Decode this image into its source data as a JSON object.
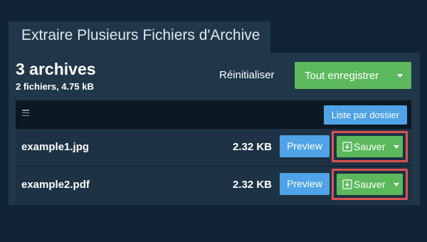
{
  "window": {
    "tab_title": "Extraire Plusieurs Fichiers d'Archive"
  },
  "summary": {
    "title": "3 archives",
    "subtitle": "2 fichiers, 4.75 kB"
  },
  "actions": {
    "reset_label": "Réinitialiser",
    "save_all_label": "Tout enregistrer"
  },
  "toolbar": {
    "menu_icon": "hamburger-icon",
    "by_folder_label": "Liste par dossier"
  },
  "files": [
    {
      "name": "example1.jpg",
      "size": "2.32 KB",
      "preview_label": "Preview",
      "save_label": "Sauver"
    },
    {
      "name": "example2.pdf",
      "size": "2.32 KB",
      "preview_label": "Preview",
      "save_label": "Sauver"
    }
  ],
  "colors": {
    "background": "#102436",
    "panel": "#203649",
    "success": "#5cb85c",
    "primary": "#4fa3e6",
    "highlight": "#d9534f"
  },
  "icons": {
    "save": "download-icon",
    "dropdown": "caret-down-icon"
  }
}
